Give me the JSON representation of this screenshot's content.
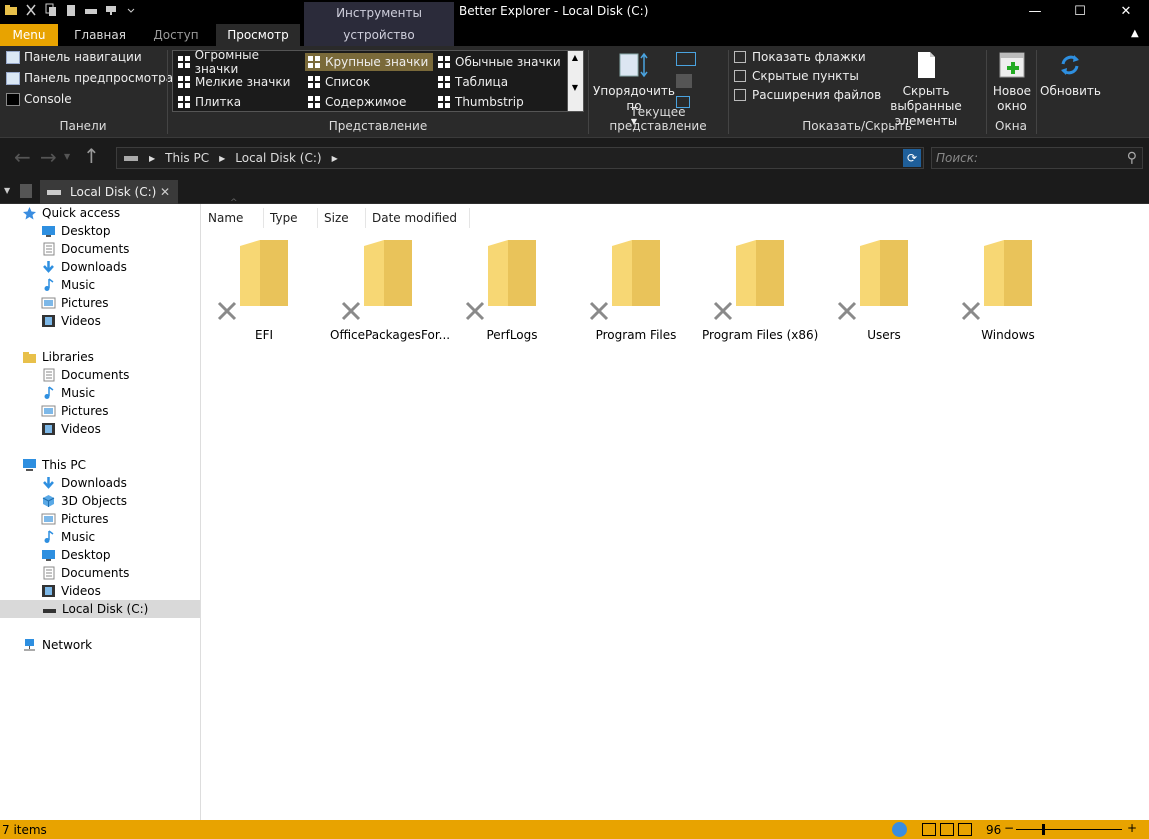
{
  "window": {
    "title": "Better Explorer - Local Disk (C:)",
    "context_group": "Инструменты устройства",
    "minimize": "—",
    "maximize": "☐",
    "close": "✕"
  },
  "ribbon_tabs": {
    "menu": "Menu",
    "home": "Главная",
    "share": "Доступ",
    "view": "Просмотр",
    "device": "устройство"
  },
  "ribbon": {
    "panes": {
      "label": "Панели",
      "navigation": "Панель навигации",
      "preview": "Панель предпросмотра",
      "console": "Console"
    },
    "layout": {
      "label": "Представление",
      "items": [
        "Огромные значки",
        "Крупные значки",
        "Обычные значки",
        "Мелкие значки",
        "Список",
        "Таблица",
        "Плитка",
        "Содержимое",
        "Thumbstrip"
      ],
      "selected": "Крупные значки"
    },
    "current_view": {
      "label": "Текущее представление",
      "sort_by": "Упорядочить по"
    },
    "show_hide": {
      "label": "Показать/Скрыть",
      "checkboxes": [
        "Показать флажки",
        "Скрытые пункты",
        "Расширения файлов"
      ],
      "hide_selected": "Скрыть выбранные элементы"
    },
    "window": {
      "label": "Окна",
      "new_window": "Новое окно"
    },
    "refresh": "Обновить"
  },
  "address": {
    "crumbs": [
      "This PC",
      "Local Disk (C:)"
    ],
    "search_placeholder": "Поиск:"
  },
  "doc_tab": {
    "label": "Local Disk (C:)",
    "close": "✕"
  },
  "tree": {
    "quick_access": "Quick access",
    "quick_items": [
      "Desktop",
      "Documents",
      "Downloads",
      "Music",
      "Pictures",
      "Videos"
    ],
    "libraries": "Libraries",
    "library_items": [
      "Documents",
      "Music",
      "Pictures",
      "Videos"
    ],
    "this_pc": "This PC",
    "pc_items": [
      "Downloads",
      "3D Objects",
      "Pictures",
      "Music",
      "Desktop",
      "Documents",
      "Videos",
      "Local Disk (C:)"
    ],
    "network": "Network"
  },
  "columns": [
    "Name",
    "Type",
    "Size",
    "Date modified"
  ],
  "folders": [
    "EFI",
    "OfficePackagesFor...",
    "PerfLogs",
    "Program Files",
    "Program Files (x86)",
    "Users",
    "Windows"
  ],
  "status": {
    "items": "7 items",
    "zoom": "96",
    "zoom_fraction": 0.25
  },
  "colors": {
    "accent": "#e8a300",
    "ribbon_bg": "#2a2a2a",
    "folder": "#f7d774"
  }
}
